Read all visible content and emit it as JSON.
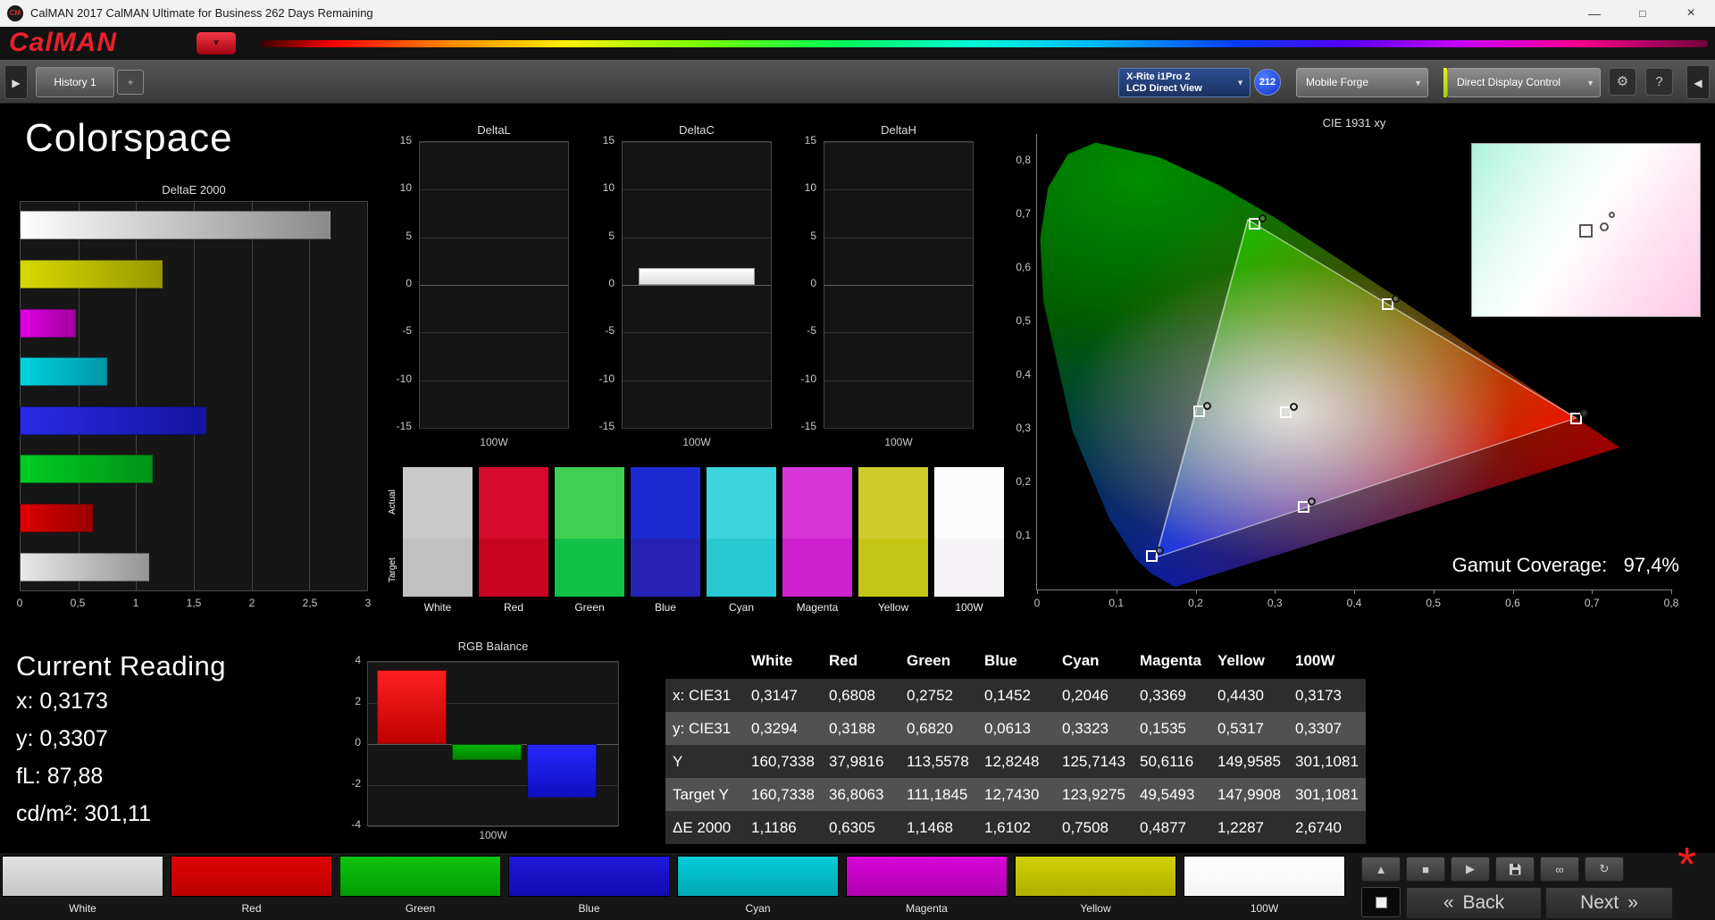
{
  "window": {
    "title": "CalMAN 2017 CalMAN Ultimate for Business 262 Days Remaining"
  },
  "icons": {
    "app": "CM",
    "minimize": "—",
    "maximize": "□",
    "close": "×",
    "dropdown": "▼",
    "panel_expand_right": "▶",
    "panel_collapse_left": "◀",
    "gear": "⚙",
    "help": "?",
    "back_chevron": "«",
    "next_chevron": "»",
    "asterisk": "*"
  },
  "brand": {
    "logo": "CalMAN",
    "accent": "#e8202c"
  },
  "toolbar": {
    "history_tab": "History 1",
    "add_tab": "+",
    "meter_line1": "X-Rite i1Pro 2",
    "meter_line2": "LCD Direct View",
    "badge": "212",
    "pattern_source": "Mobile Forge",
    "display_control": "Direct Display Control"
  },
  "page_title": "Colorspace",
  "deltae_chart": {
    "type": "bar",
    "title": "DeltaE 2000",
    "xticks": [
      "0",
      "0,5",
      "1",
      "1,5",
      "2",
      "2,5",
      "3"
    ],
    "xmax": 3,
    "bars": [
      {
        "name": "100W",
        "value": 2.674,
        "color1": "#ffffff",
        "color2": "#8a8a8a"
      },
      {
        "name": "Yellow",
        "value": 1.2287,
        "color1": "#d8d800",
        "color2": "#989800"
      },
      {
        "name": "Magenta",
        "value": 0.4877,
        "color1": "#e000e0",
        "color2": "#a000a0"
      },
      {
        "name": "Cyan",
        "value": 0.7508,
        "color1": "#00d2e0",
        "color2": "#0096a6"
      },
      {
        "name": "Blue",
        "value": 1.6102,
        "color1": "#2a2ae6",
        "color2": "#1414a0"
      },
      {
        "name": "Green",
        "value": 1.1468,
        "color1": "#00cc22",
        "color2": "#009416"
      },
      {
        "name": "Red",
        "value": 0.6305,
        "color1": "#dd0000",
        "color2": "#990000"
      },
      {
        "name": "White",
        "value": 1.1186,
        "color1": "#e8e8e8",
        "color2": "#949494"
      }
    ]
  },
  "delta_small_charts": {
    "yticks": [
      "15",
      "10",
      "5",
      "0",
      "-5",
      "-10",
      "-15"
    ],
    "ymax": 15,
    "charts": [
      {
        "title": "DeltaL",
        "xlabel": "100W",
        "value": 0
      },
      {
        "title": "DeltaC",
        "xlabel": "100W",
        "value": 1.8
      },
      {
        "title": "DeltaH",
        "xlabel": "100W",
        "value": 0
      }
    ]
  },
  "swatches": {
    "row_top": "Actual",
    "row_bottom": "Target",
    "columns": [
      {
        "label": "White",
        "actual": "#c9c9c9",
        "target": "#c1c1c1"
      },
      {
        "label": "Red",
        "actual": "#d50a2c",
        "target": "#c70421"
      },
      {
        "label": "Green",
        "actual": "#3fd052",
        "target": "#10c348"
      },
      {
        "label": "Blue",
        "actual": "#1d2ad2",
        "target": "#2622b6"
      },
      {
        "label": "Cyan",
        "actual": "#3cd4dc",
        "target": "#28c8d0"
      },
      {
        "label": "Magenta",
        "actual": "#d836d8",
        "target": "#cf1fcf"
      },
      {
        "label": "Yellow",
        "actual": "#cfcb2a",
        "target": "#c5c514"
      },
      {
        "label": "100W",
        "actual": "#fcfcfc",
        "target": "#f6f3f6"
      }
    ]
  },
  "cie": {
    "title": "CIE 1931 xy",
    "xticks": [
      "0",
      "0,1",
      "0,2",
      "0,3",
      "0,4",
      "0,5",
      "0,6",
      "0,7",
      "0,8"
    ],
    "yticks": [
      "0,8",
      "0,7",
      "0,6",
      "0,5",
      "0,4",
      "0,3",
      "0,2",
      "0,1"
    ],
    "gamut_label": "Gamut Coverage:",
    "gamut_value": "97,4%",
    "points": [
      {
        "name": "white",
        "x": 0.3147,
        "y": 0.3294
      },
      {
        "name": "red",
        "x": 0.6808,
        "y": 0.3188
      },
      {
        "name": "green",
        "x": 0.2752,
        "y": 0.682
      },
      {
        "name": "blue",
        "x": 0.1452,
        "y": 0.0613
      },
      {
        "name": "cyan",
        "x": 0.2046,
        "y": 0.3323
      },
      {
        "name": "magenta",
        "x": 0.3369,
        "y": 0.1535
      },
      {
        "name": "yellow",
        "x": 0.443,
        "y": 0.5317
      }
    ]
  },
  "current_reading": {
    "title": "Current Reading",
    "x": "x: 0,3173",
    "y": "y: 0,3307",
    "fl": "fL: 87,88",
    "cdm2": "cd/m²: 301,11"
  },
  "rgb_chart": {
    "type": "bar",
    "title": "RGB Balance",
    "xlabel": "100W",
    "yticks": [
      "4",
      "2",
      "0",
      "-2",
      "-4"
    ],
    "ymax": 4,
    "bars": [
      {
        "name": "red",
        "value": 3.6,
        "color1": "#ff2020",
        "color2": "#c00000"
      },
      {
        "name": "green",
        "value": -0.8,
        "color1": "#00b400",
        "color2": "#008000"
      },
      {
        "name": "blue",
        "value": -2.6,
        "color1": "#2828ff",
        "color2": "#0e0ec0"
      }
    ]
  },
  "table": {
    "columns": [
      "White",
      "Red",
      "Green",
      "Blue",
      "Cyan",
      "Magenta",
      "Yellow",
      "100W"
    ],
    "rows": [
      {
        "label": "x: CIE31",
        "values": [
          "0,3147",
          "0,6808",
          "0,2752",
          "0,1452",
          "0,2046",
          "0,3369",
          "0,4430",
          "0,3173"
        ]
      },
      {
        "label": "y: CIE31",
        "values": [
          "0,3294",
          "0,3188",
          "0,6820",
          "0,0613",
          "0,3323",
          "0,1535",
          "0,5317",
          "0,3307"
        ]
      },
      {
        "label": "Y",
        "values": [
          "160,7338",
          "37,9816",
          "113,5578",
          "12,8248",
          "125,7143",
          "50,6116",
          "149,9585",
          "301,1081"
        ]
      },
      {
        "label": "Target Y",
        "values": [
          "160,7338",
          "36,8063",
          "111,1845",
          "12,7430",
          "123,9275",
          "49,5493",
          "147,9908",
          "301,1081"
        ]
      },
      {
        "label": "ΔE 2000",
        "values": [
          "1,1186",
          "0,6305",
          "1,1468",
          "1,6102",
          "0,7508",
          "0,4877",
          "1,2287",
          "2,6740"
        ]
      }
    ]
  },
  "bottom": {
    "patches": [
      {
        "label": "White",
        "color1": "#e2e2e2",
        "color2": "#c6c6c6"
      },
      {
        "label": "Red",
        "color1": "#e00404",
        "color2": "#bc0000"
      },
      {
        "label": "Green",
        "color1": "#0cc40c",
        "color2": "#049c04"
      },
      {
        "label": "Blue",
        "color1": "#2018dc",
        "color2": "#100cb0"
      },
      {
        "label": "Cyan",
        "color1": "#04ccd8",
        "color2": "#00a8b4"
      },
      {
        "label": "Magenta",
        "color1": "#d804d8",
        "color2": "#b000b0"
      },
      {
        "label": "Yellow",
        "color1": "#d0d004",
        "color2": "#b0b000"
      },
      {
        "label": "100W",
        "color1": "#ffffff",
        "color2": "#f4f4f4"
      }
    ],
    "transport": [
      {
        "name": "eject",
        "glyph": "▲"
      },
      {
        "name": "stop",
        "glyph": "■"
      },
      {
        "name": "play",
        "glyph": "▶"
      },
      {
        "name": "save",
        "glyph": ""
      },
      {
        "name": "loop",
        "glyph": "∞"
      },
      {
        "name": "refresh",
        "glyph": "↻"
      }
    ],
    "back": "Back",
    "next": "Next"
  }
}
